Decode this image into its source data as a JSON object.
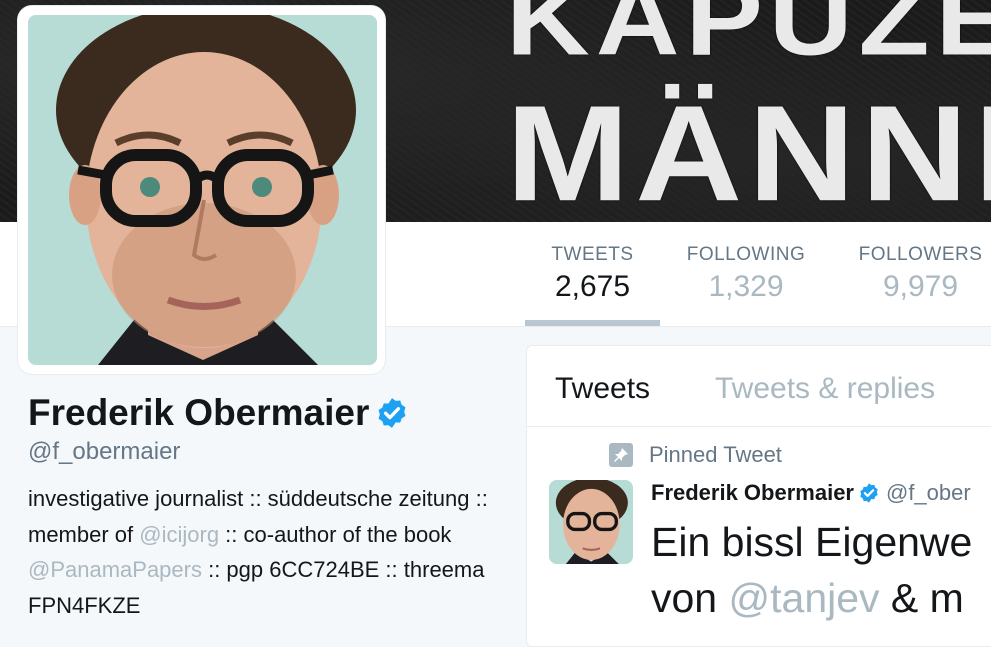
{
  "banner": {
    "line1": "KAPUZEN",
    "line2": "MÄNNER"
  },
  "stats": [
    {
      "label": "TWEETS",
      "value": "2,675",
      "active": true
    },
    {
      "label": "FOLLOWING",
      "value": "1,329",
      "active": false
    },
    {
      "label": "FOLLOWERS",
      "value": "9,979",
      "active": false
    }
  ],
  "profile": {
    "name": "Frederik Obermaier",
    "handle": "@f_obermaier",
    "bio": {
      "p1": "investigative journalist :: süddeutsche zeitung :: member of ",
      "m1": "@icijorg",
      "p2": " :: co-author of the book ",
      "m2": "@PanamaPapers",
      "p3": " :: pgp 6CC724BE :: threema FPN4FKZE"
    }
  },
  "timeline": {
    "tabs": [
      "Tweets",
      "Tweets & replies"
    ],
    "pinned_label": "Pinned Tweet",
    "tweet": {
      "name": "Frederik Obermaier",
      "handle": "@f_ober",
      "line1": "Ein bissl Eigenwe",
      "line2_prefix": "von ",
      "line2_mention": "@tanjev",
      "line2_suffix": " & m"
    }
  },
  "colors": {
    "accent": "#1da1f2",
    "muted": "#aab8c2",
    "verified": "#1da1f2"
  }
}
